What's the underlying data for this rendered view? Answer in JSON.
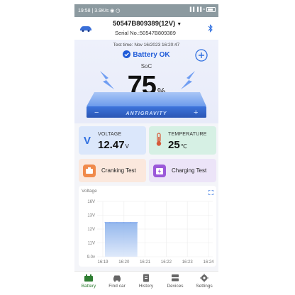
{
  "status_bar": {
    "time": "19:58",
    "net_speed": "3.9K/s",
    "indicators": "▐▐ ▐▐",
    "battery_pct": "100"
  },
  "header": {
    "device_name": "50547B809389(12V)",
    "serial": "Serial No.:50547B809389"
  },
  "hero": {
    "test_time": "Test time: Nov 16/2023 16:20:47",
    "status": "Battery OK",
    "soc_label": "SoC",
    "soc_value": "75",
    "soc_unit": "%",
    "brand": "ANTIGRAVITY",
    "soc_fraction": 0.75
  },
  "cards": {
    "voltage": {
      "label": "VOLTAGE",
      "value": "12.47",
      "unit": "V"
    },
    "temperature": {
      "label": "TEMPERATURE",
      "value": "25",
      "unit": "℃"
    }
  },
  "tests": {
    "cranking": "Cranking Test",
    "charging": "Charging Test"
  },
  "chart_data": {
    "type": "area",
    "title": "Voltage",
    "y_ticks": [
      "16V",
      "13V",
      "12V",
      "11V",
      "9.0v"
    ],
    "x_ticks": [
      "16:19",
      "16:20",
      "16:21",
      "16:22",
      "16:23",
      "16:24"
    ],
    "ylim": [
      9,
      16
    ],
    "series": [
      {
        "x": [
          "16:19:06",
          "16:19:20",
          "16:19:40",
          "16:20:00",
          "16:20:20",
          "16:20:38"
        ],
        "values": [
          12.47,
          12.47,
          12.47,
          12.47,
          12.47,
          12.47
        ]
      }
    ],
    "grid": true,
    "colors": {
      "fill_top": "#8fb4ec",
      "fill_bottom": "#dde8fa"
    }
  },
  "nav": {
    "items": [
      {
        "label": "Battery"
      },
      {
        "label": "Find car"
      },
      {
        "label": "History"
      },
      {
        "label": "Devices"
      },
      {
        "label": "Settings"
      }
    ]
  },
  "colors": {
    "accent": "#1f5bd8",
    "active_nav": "#2e7d32",
    "battery_body": "#3a6fd8"
  }
}
